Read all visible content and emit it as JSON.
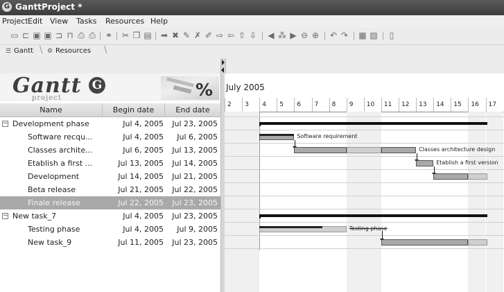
{
  "window": {
    "title": "GanttProject *"
  },
  "menu": [
    "Project",
    "Edit",
    "View",
    "Tasks",
    "Resources",
    "Help"
  ],
  "tabs": [
    {
      "label": "Gantt",
      "icon": "gantt-icon"
    },
    {
      "label": "Resources",
      "icon": "resources-icon"
    }
  ],
  "logo": {
    "text": "Gantt",
    "sub": "project",
    "badge": "G",
    "percent": "%"
  },
  "grid": {
    "headers": {
      "name": "Name",
      "begin": "Begin date",
      "end": "End date"
    },
    "rows": [
      {
        "name": "Development phase",
        "begin": "Jul 4, 2005",
        "end": "Jul 23, 2005",
        "level": 0,
        "expander": "−"
      },
      {
        "name": "Software recqu...",
        "begin": "Jul 4, 2005",
        "end": "Jul 6, 2005",
        "level": 1
      },
      {
        "name": "Classes archite...",
        "begin": "Jul 6, 2005",
        "end": "Jul 13, 2005",
        "level": 1
      },
      {
        "name": "Etablish a first ...",
        "begin": "Jul 13, 2005",
        "end": "Jul 14, 2005",
        "level": 1
      },
      {
        "name": "Development",
        "begin": "Jul 14, 2005",
        "end": "Jul 21, 2005",
        "level": 1
      },
      {
        "name": "Beta release",
        "begin": "Jul 21, 2005",
        "end": "Jul 22, 2005",
        "level": 1
      },
      {
        "name": "Finale release",
        "begin": "Jul 22, 2005",
        "end": "Jul 23, 2005",
        "level": 1,
        "selected": true
      },
      {
        "name": "New task_7",
        "begin": "Jul 4, 2005",
        "end": "Jul 23, 2005",
        "level": 0,
        "expander": "−"
      },
      {
        "name": "Testing phase",
        "begin": "Jul 4, 2005",
        "end": "Jul 9, 2005",
        "level": 1
      },
      {
        "name": "New task_9",
        "begin": "Jul 11, 2005",
        "end": "Jul 23, 2005",
        "level": 1
      }
    ]
  },
  "chart": {
    "month": "July 2005",
    "days": [
      "2",
      "3",
      "4",
      "5",
      "6",
      "7",
      "8",
      "9",
      "10",
      "11",
      "12",
      "13",
      "14",
      "15",
      "16",
      "17"
    ],
    "labels": {
      "software": "Software requirement",
      "classes": "Classes architecture design",
      "etablish": "Etablish a first version",
      "testing": "Testing phase"
    }
  }
}
